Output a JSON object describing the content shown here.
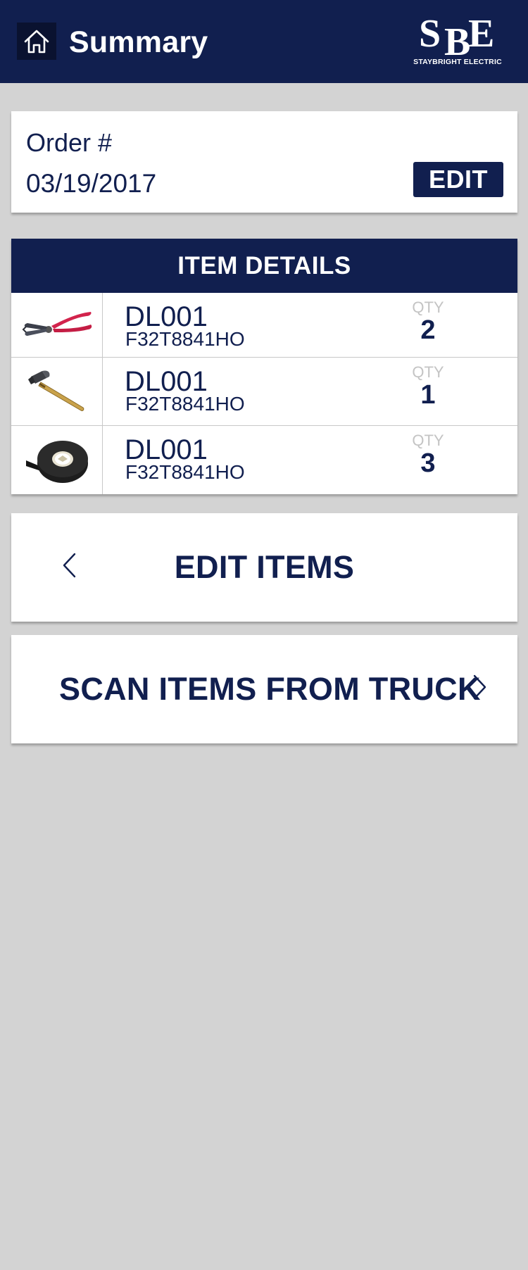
{
  "header": {
    "title": "Summary",
    "home_icon": "home-icon",
    "logo": {
      "letters": [
        "S",
        "B",
        "E"
      ],
      "tagline": "STAYBRIGHT ELECTRIC"
    }
  },
  "order": {
    "label": "Order #",
    "date": "03/19/2017",
    "edit_label": "EDIT"
  },
  "item_details": {
    "title": "ITEM DETAILS",
    "qty_label": "QTY",
    "items": [
      {
        "icon": "wire-cutter-icon",
        "code": "DL001",
        "part": "F32T8841HO",
        "qty": "2"
      },
      {
        "icon": "hammer-icon",
        "code": "DL001",
        "part": "F32T8841HO",
        "qty": "1"
      },
      {
        "icon": "electrical-tape-icon",
        "code": "DL001",
        "part": "F32T8841HO",
        "qty": "3"
      }
    ]
  },
  "actions": {
    "edit_items_label": "EDIT ITEMS",
    "scan_items_label": "SCAN ITEMS FROM TRUCK"
  },
  "colors": {
    "brand_navy": "#111f4f",
    "background": "#d3d3d3",
    "qty_label_gray": "#c4c4c4"
  }
}
